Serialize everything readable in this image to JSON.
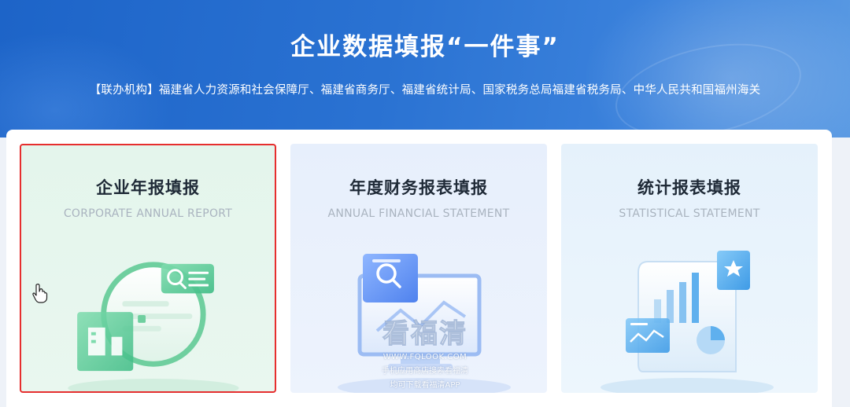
{
  "header": {
    "title": "企业数据填报“一件事”",
    "organizers": "【联办机构】福建省人力资源和社会保障厅、福建省商务厅、福建省统计局、国家税务总局福建省税务局、中华人民共和国福州海关"
  },
  "cards": [
    {
      "title": "企业年报填报",
      "subtitle": "CORPORATE ANNUAL REPORT",
      "selected": true,
      "accent": "#3dbb84"
    },
    {
      "title": "年度财务报表填报",
      "subtitle": "ANNUAL FINANCIAL STATEMENT",
      "selected": false,
      "accent": "#5b8ff2"
    },
    {
      "title": "统计报表填报",
      "subtitle": "STATISTICAL STATEMENT",
      "selected": false,
      "accent": "#4aa8ee"
    }
  ],
  "watermark": {
    "brand": "看福清",
    "url": "WWW.FQLOOK.COM",
    "line1": "手机应用商店搜索看福清",
    "line2": "均可下载看福清APP"
  },
  "colors": {
    "banner": "#1d64c8",
    "selected_border": "#e62e2e"
  }
}
